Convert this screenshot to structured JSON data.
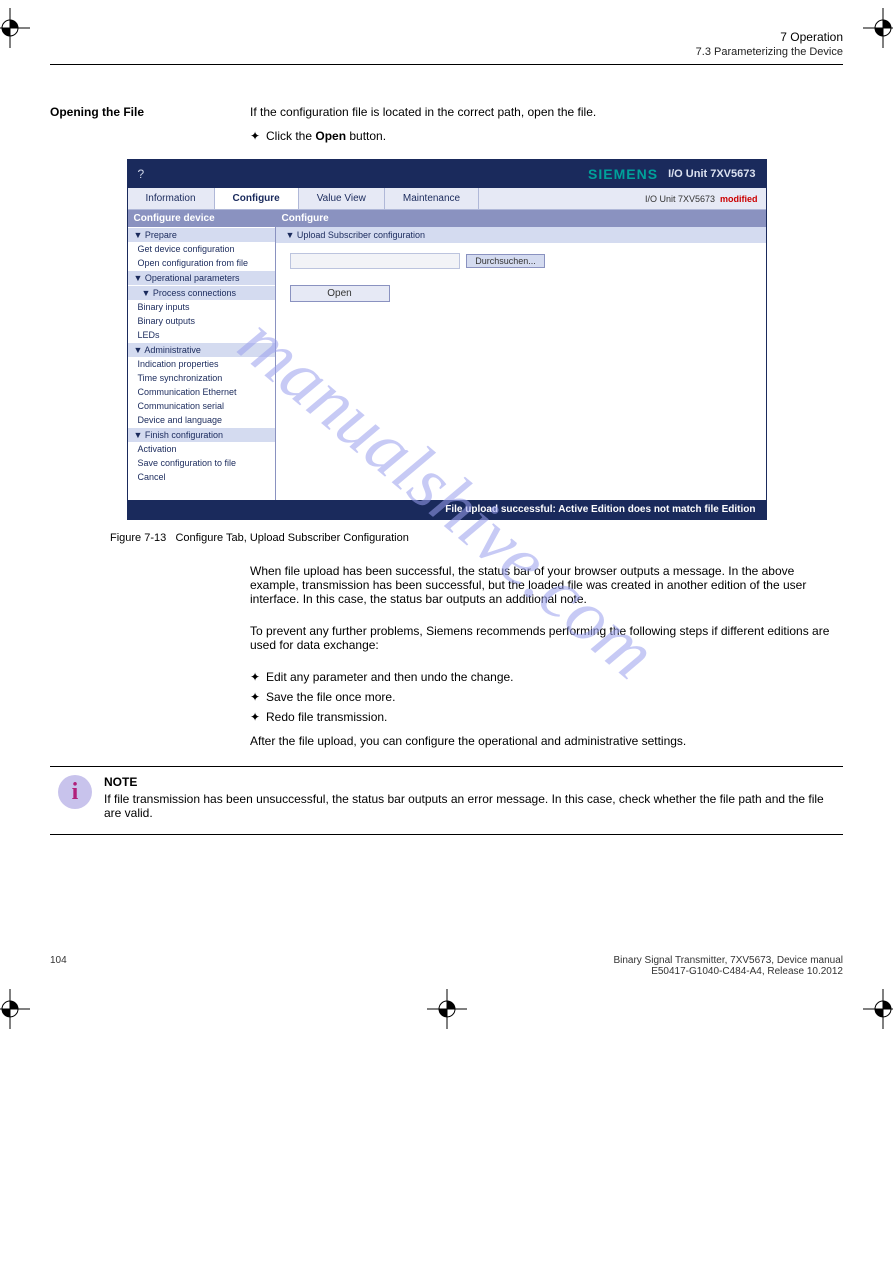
{
  "chapter": {
    "num": "7",
    "title": "Operation"
  },
  "section": "7.3 Parameterizing the Device",
  "subheading": {
    "label": "Opening the File",
    "text": "If the configuration file is located in the correct path, open the file."
  },
  "pre_screenshot": "Click the Open button.",
  "screenshot": {
    "help_icon": "?",
    "brand": "SIEMENS",
    "unit": "I/O  Unit 7XV5673",
    "tabs": [
      "Information",
      "Configure",
      "Value View",
      "Maintenance"
    ],
    "active_tab": 1,
    "status_device": "I/O Unit 7XV5673",
    "status_flag": "modified",
    "side_head": "Configure device",
    "groups": [
      {
        "label": "▼ Prepare",
        "items": [
          "Get device configuration",
          "Open configuration from file"
        ]
      },
      {
        "label": "▼ Operational parameters",
        "sub": "▼ Process connections",
        "items": [
          "Binary inputs",
          "Binary outputs",
          "LEDs"
        ]
      },
      {
        "label": "▼ Administrative",
        "items": [
          "Indication properties",
          "Time synchronization",
          "Communication Ethernet",
          "Communication serial",
          "Device and language"
        ]
      },
      {
        "label": "▼ Finish configuration",
        "items": [
          "Activation",
          "Save configuration to file",
          "Cancel"
        ]
      }
    ],
    "main_head": "Configure",
    "main_sub": "▼ Upload Subscriber configuration",
    "browse": "Durchsuchen...",
    "open": "Open",
    "footer": "File upload successful: Active Edition does not match file Edition"
  },
  "fig": {
    "num": "Figure 7-13",
    "caption": "Configure Tab, Upload Subscriber Configuration"
  },
  "after_fig": [
    "When file upload has been successful, the status bar of your browser outputs a message. In the above example, transmission has been successful, but the loaded file was created in another edition of the user interface. In this case, the status bar outputs an additional note.",
    "To prevent any further problems, Siemens recommends performing the following steps if different editions are used for data exchange:"
  ],
  "bullets": [
    "Edit any parameter and then undo the change.",
    "Save the file once more.",
    "Redo file transmission."
  ],
  "final": "After the file upload, you can configure the operational and administrative settings.",
  "note": {
    "title": "NOTE",
    "text": "If file transmission has been unsuccessful, the status bar outputs an error message. In this case, check whether the file path and the file are valid."
  },
  "footer": {
    "page": "104",
    "manual": "Binary Signal Transmitter, 7XV5673, Device manual",
    "rev": "E50417-G1040-C484-A4, Release 10.2012"
  },
  "watermark": "manualshive.com"
}
